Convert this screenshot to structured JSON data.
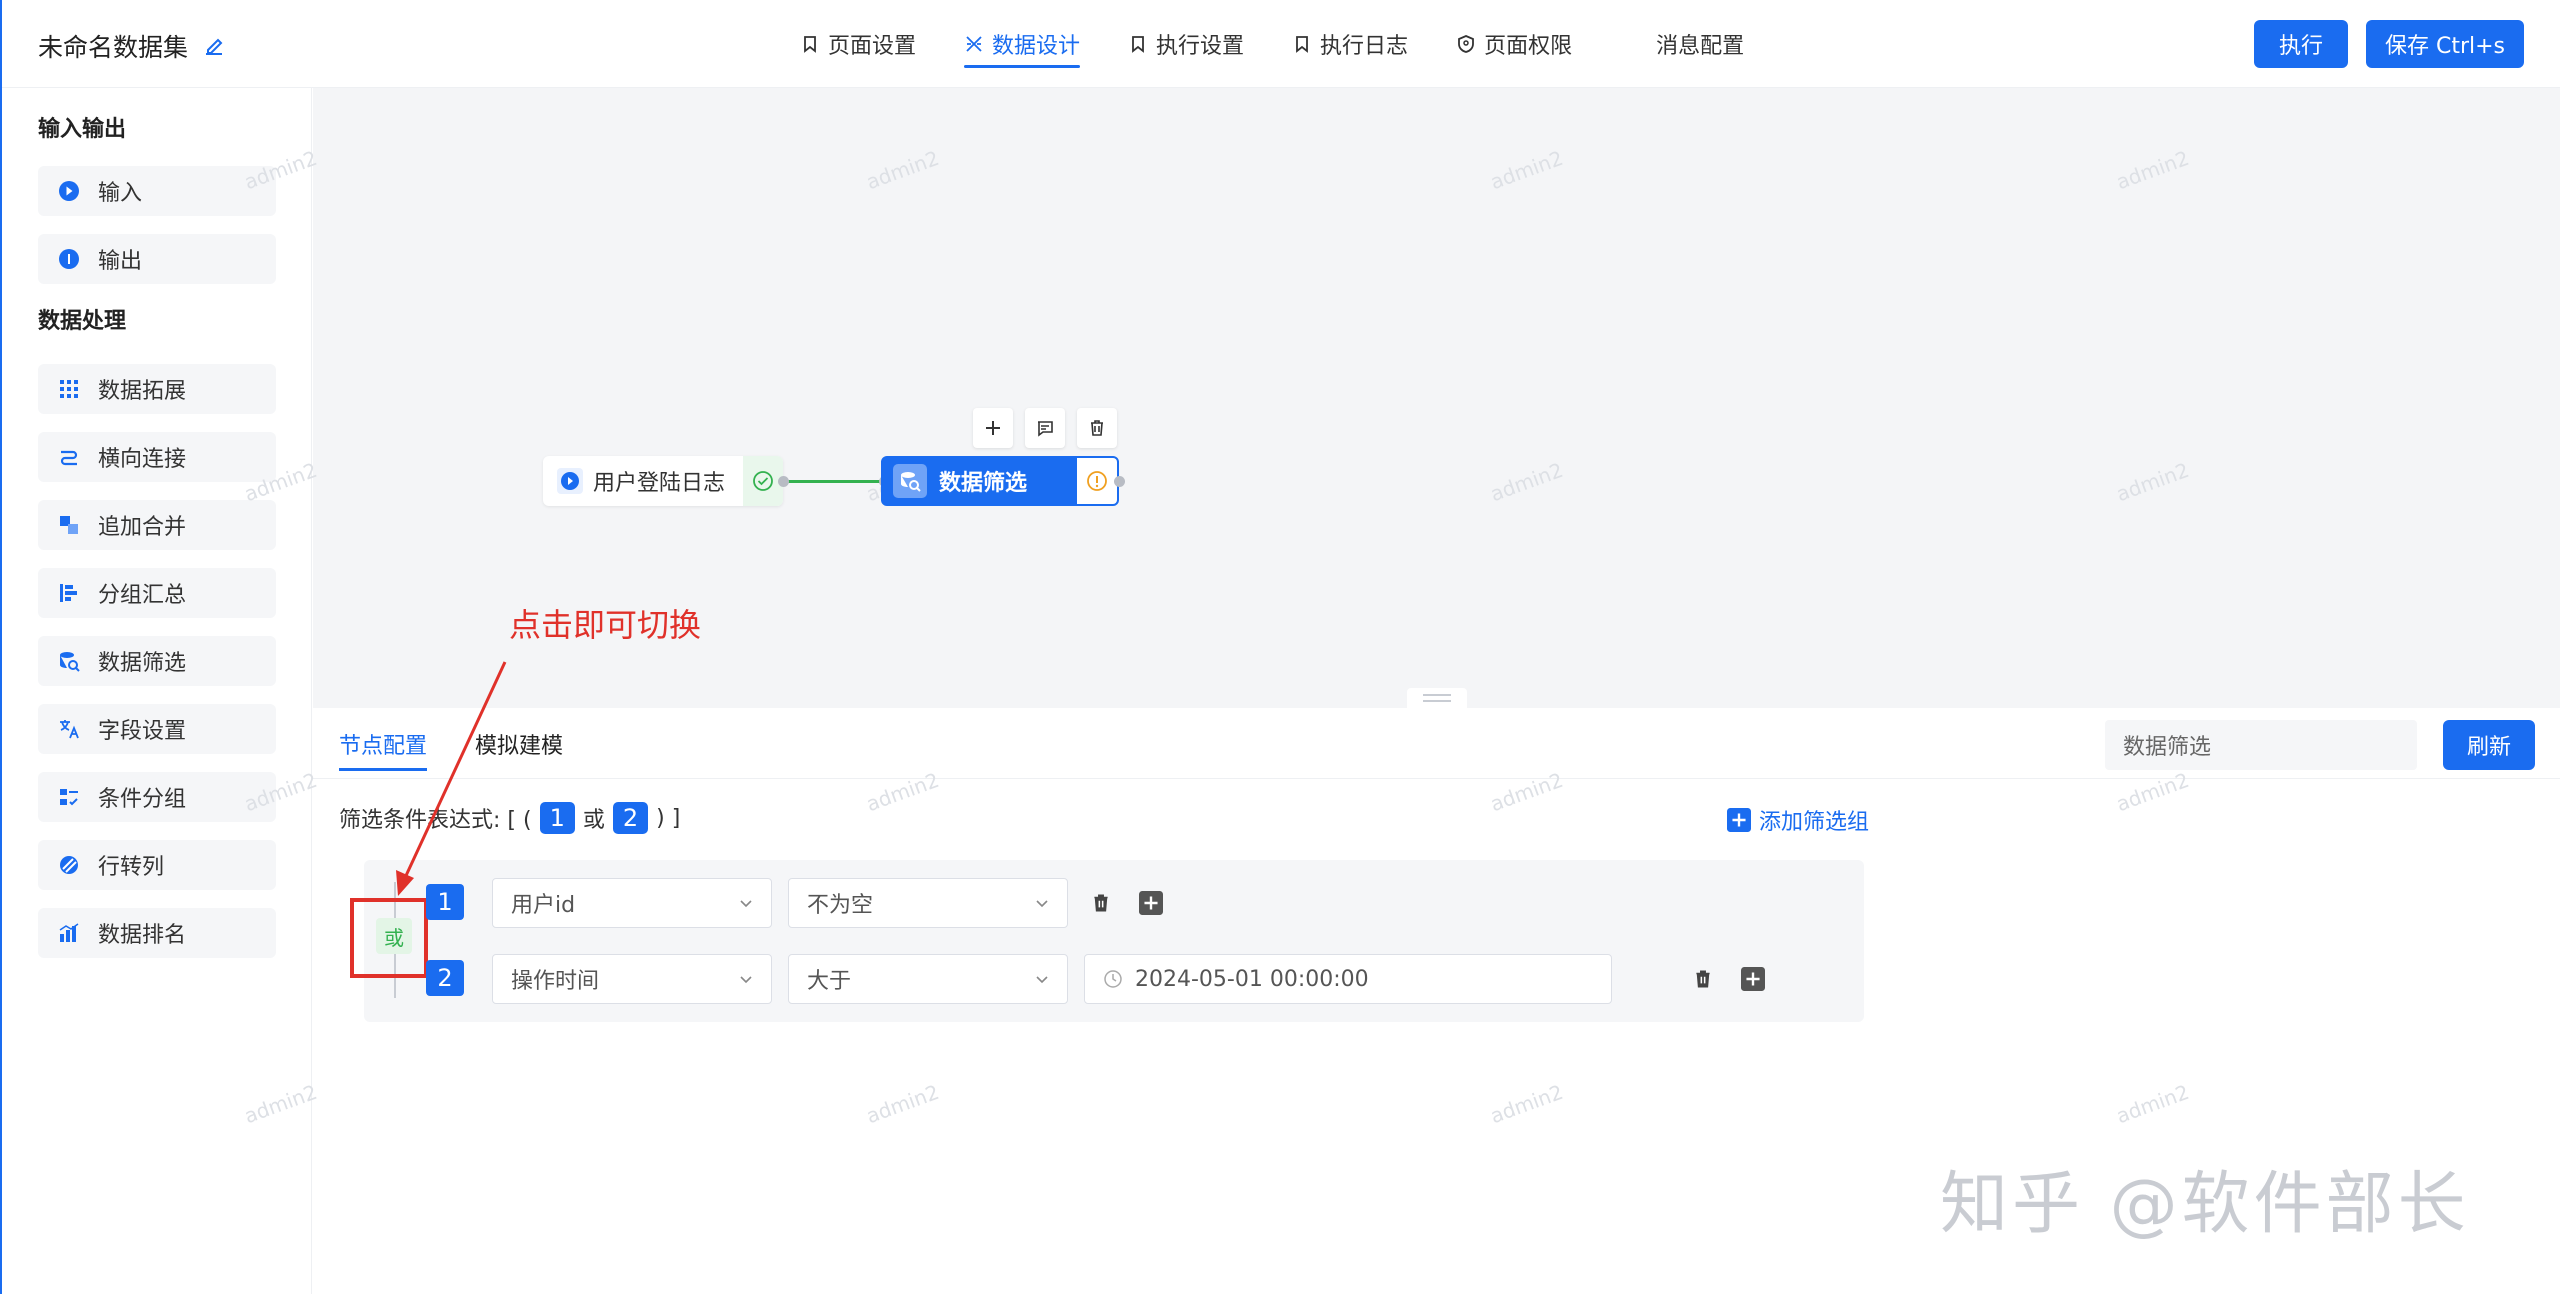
{
  "header": {
    "title": "未命名数据集",
    "nav": [
      {
        "label": "页面设置",
        "icon": "bookmark-icon"
      },
      {
        "label": "数据设计",
        "icon": "design-icon"
      },
      {
        "label": "执行设置",
        "icon": "bookmark-icon"
      },
      {
        "label": "执行日志",
        "icon": "bookmark-icon"
      },
      {
        "label": "页面权限",
        "icon": "shield-icon"
      },
      {
        "label": "消息配置",
        "icon": ""
      }
    ],
    "execute_label": "执行",
    "save_label": "保存 Ctrl+s"
  },
  "sidebar": {
    "section_io": "输入输出",
    "io_items": [
      {
        "label": "输入",
        "icon": "play-circle-icon"
      },
      {
        "label": "输出",
        "icon": "info-circle-icon"
      }
    ],
    "section_processing": "数据处理",
    "processing_items": [
      {
        "label": "数据拓展",
        "icon": "grid-icon"
      },
      {
        "label": "横向连接",
        "icon": "join-icon"
      },
      {
        "label": "追加合并",
        "icon": "merge-icon"
      },
      {
        "label": "分组汇总",
        "icon": "group-icon"
      },
      {
        "label": "数据筛选",
        "icon": "filter-db-icon"
      },
      {
        "label": "字段设置",
        "icon": "translate-icon"
      },
      {
        "label": "条件分组",
        "icon": "condition-icon"
      },
      {
        "label": "行转列",
        "icon": "pivot-icon"
      },
      {
        "label": "数据排名",
        "icon": "ranking-icon"
      }
    ]
  },
  "canvas": {
    "watermark": "admin2",
    "source_node": "用户登陆日志",
    "filter_node": "数据筛选",
    "annotation": "点击即可切换"
  },
  "panel": {
    "tabs": [
      "节点配置",
      "模拟建模"
    ],
    "node_name_value": "数据筛选",
    "refresh_label": "刷新",
    "expression_label": "筛选条件表达式: [ (",
    "expr_num1": "1",
    "expr_or": "或",
    "expr_num2": "2",
    "expr_end": ") ]",
    "add_group_label": "添加筛选组",
    "logic_toggle": "或",
    "rows": [
      {
        "num": "1",
        "field": "用户id",
        "operator": "不为空",
        "value": ""
      },
      {
        "num": "2",
        "field": "操作时间",
        "operator": "大于",
        "value": "2024-05-01 00:00:00"
      }
    ]
  },
  "footer_watermark": "知乎 @软件部长",
  "colors": {
    "primary": "#1a6cf0",
    "annotation": "#e0312a",
    "success": "#33b14f",
    "warning": "#f0a020"
  }
}
